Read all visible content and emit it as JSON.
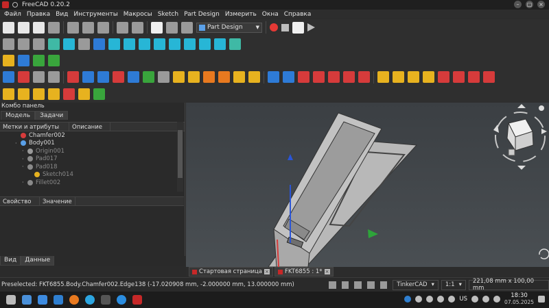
{
  "window": {
    "title": "FreeCAD 0.20.2"
  },
  "menu": [
    "Файл",
    "Правка",
    "Вид",
    "Инструменты",
    "Макросы",
    "Sketch",
    "Part Design",
    "Измерить",
    "Окна",
    "Справка"
  ],
  "toolbar": {
    "workbench": "Part Design"
  },
  "combo": {
    "title": "Комбо панель",
    "tabs": [
      "Модель",
      "Задачи"
    ],
    "tree_columns": [
      "Метки и атрибуты",
      "Описание"
    ],
    "tree": [
      {
        "label": "Chamfer002",
        "indent": 0,
        "dim": false
      },
      {
        "label": "Body001",
        "indent": 0,
        "dim": false
      },
      {
        "label": "Origin001",
        "indent": 1,
        "dim": true
      },
      {
        "label": "Pad017",
        "indent": 1,
        "dim": true
      },
      {
        "label": "Pad018",
        "indent": 1,
        "dim": true
      },
      {
        "label": "Sketch014",
        "indent": 2,
        "dim": true
      },
      {
        "label": "Fillet002",
        "indent": 1,
        "dim": true
      }
    ],
    "prop_columns": [
      "Свойство",
      "Значение"
    ],
    "bottom_tabs": [
      "Вид",
      "Данные"
    ]
  },
  "doc_tabs": [
    {
      "label": "Стартовая страница",
      "active": false
    },
    {
      "label": "FKT6855 : 1*",
      "active": true
    }
  ],
  "status": {
    "message": "Preselected: FKT6855.Body.Chamfer002.Edge138 (-17.020908 mm, -2.000000 mm, 13.000000 mm)",
    "nav_style": "TinkerCAD",
    "zoom": "1:1",
    "dimensions": "221,08 mm x 100,00 mm"
  },
  "taskbar": {
    "lang": "US",
    "time": "18:30",
    "date": "07.05.2025"
  }
}
